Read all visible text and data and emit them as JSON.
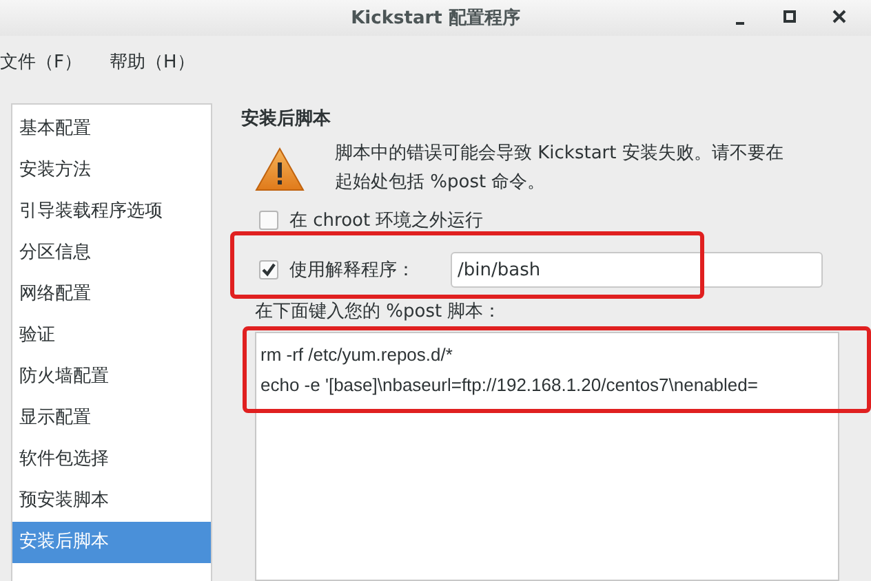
{
  "window": {
    "title": "Kickstart 配置程序"
  },
  "menu": [
    "文件（F）",
    "帮助（H）"
  ],
  "sidebar": {
    "items": [
      {
        "label": "基本配置",
        "selected": false
      },
      {
        "label": "安装方法",
        "selected": false
      },
      {
        "label": "引导装载程序选项",
        "selected": false
      },
      {
        "label": "分区信息",
        "selected": false
      },
      {
        "label": "网络配置",
        "selected": false
      },
      {
        "label": "验证",
        "selected": false
      },
      {
        "label": "防火墙配置",
        "selected": false
      },
      {
        "label": "显示配置",
        "selected": false
      },
      {
        "label": "软件包选择",
        "selected": false
      },
      {
        "label": "预安装脚本",
        "selected": false
      },
      {
        "label": "安装后脚本",
        "selected": true
      }
    ]
  },
  "panel": {
    "heading": "安装后脚本",
    "warning": "脚本中的错误可能会导致 Kickstart 安装失败。请不要在起始处包括 %post 命令。",
    "chroot_option": {
      "label": "在 chroot 环境之外运行",
      "checked": false
    },
    "interpreter": {
      "label": "使用解释程序：",
      "checked": true,
      "value": "/bin/bash",
      "highlighted": true
    },
    "script_label": "在下面键入您的 %post 脚本：",
    "script": {
      "lines": [
        "rm -rf /etc/yum.repos.d/*",
        "echo -e '[base]\\nbaseurl=ftp://192.168.1.20/centos7\\nenabled="
      ],
      "highlighted": true
    }
  }
}
